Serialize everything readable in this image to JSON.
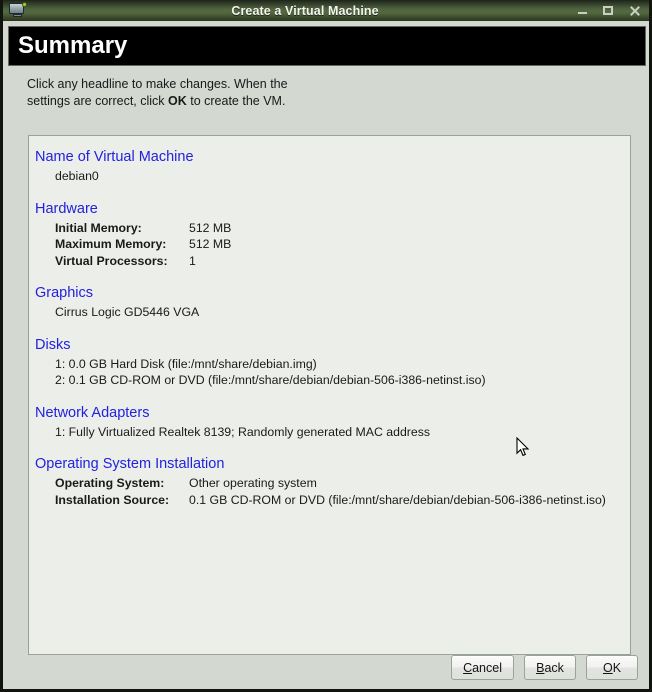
{
  "window": {
    "title": "Create a Virtual Machine",
    "icon": "computer-monitor-icon",
    "controls": {
      "minimize": "minimize-icon",
      "maximize": "maximize-icon",
      "close": "close-icon"
    }
  },
  "header": {
    "title": "Summary"
  },
  "intro": {
    "part1": "Click any headline to make changes.  When the settings are correct, click ",
    "emphasis": "OK",
    "part2": " to create the VM."
  },
  "sections": {
    "name": {
      "heading": "Name of Virtual Machine",
      "value": "debian0"
    },
    "hardware": {
      "heading": "Hardware",
      "rows": [
        {
          "key": "Initial Memory:",
          "value": "512 MB"
        },
        {
          "key": "Maximum Memory:",
          "value": "512 MB"
        },
        {
          "key": "Virtual Processors:",
          "value": "1"
        }
      ]
    },
    "graphics": {
      "heading": "Graphics",
      "value": "Cirrus Logic GD5446 VGA"
    },
    "disks": {
      "heading": "Disks",
      "lines": [
        "1: 0.0 GB Hard Disk (file:/mnt/share/debian.img)",
        "2: 0.1 GB CD-ROM or DVD (file:/mnt/share/debian/debian-506-i386-netinst.iso)"
      ]
    },
    "network": {
      "heading": "Network Adapters",
      "lines": [
        "1: Fully Virtualized Realtek 8139; Randomly generated MAC address"
      ]
    },
    "os": {
      "heading": "Operating System Installation",
      "rows": [
        {
          "key": "Operating System:",
          "value": "Other operating system"
        },
        {
          "key": "Installation Source:",
          "value": "0.1 GB CD-ROM or DVD (file:/mnt/share/debian/debian-506-i386-netinst.iso)"
        }
      ]
    }
  },
  "footer": {
    "cancel": {
      "mnemonic": "C",
      "rest": "ancel"
    },
    "back": {
      "mnemonic": "B",
      "rest": "ack"
    },
    "ok": {
      "mnemonic": "O",
      "rest": "K"
    }
  },
  "colors": {
    "link": "#2222dd",
    "header_bg": "#000000",
    "dialog_bg": "#d3d8d1",
    "panel_bg": "#eceeea",
    "titlebar_green": "#4f6340"
  }
}
